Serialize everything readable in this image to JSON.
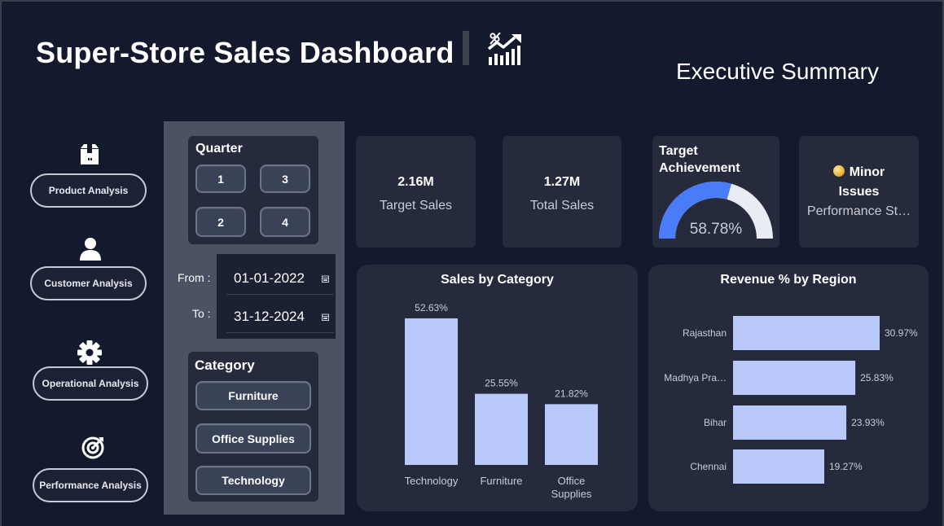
{
  "header": {
    "title": "Super-Store Sales Dashboard",
    "icon": "chart-growth-icon",
    "subtitle": "Executive Summary"
  },
  "nav": [
    {
      "label": "Product Analysis",
      "icon": "box-icon"
    },
    {
      "label": "Customer Analysis",
      "icon": "user-icon"
    },
    {
      "label": "Operational Analysis",
      "icon": "gear-icon"
    },
    {
      "label": "Performance Analysis",
      "icon": "target-icon"
    }
  ],
  "filters": {
    "quarter_heading": "Quarter",
    "quarters": [
      "1",
      "3",
      "2",
      "4"
    ],
    "from_label": "From :",
    "to_label": "To :",
    "from_date": "01-01-2022",
    "to_date": "31-12-2024",
    "category_heading": "Category",
    "categories": [
      "Furniture",
      "Office Supplies",
      "Technology"
    ]
  },
  "kpis": {
    "target_sales": {
      "value": "2.16M",
      "label": "Target Sales"
    },
    "total_sales": {
      "value": "1.27M",
      "label": "Total Sales"
    },
    "target_achievement": {
      "title_line1": "Target",
      "title_line2": "Achievement",
      "value": "58.78%",
      "fraction": 0.5878
    },
    "status": {
      "line1": "Minor",
      "line2": "Issues",
      "label": "Performance St…"
    }
  },
  "colors": {
    "background": "#141a2e",
    "card": "#252b3d",
    "bar": "#b9c9fb",
    "gauge_fill": "#4a7cf7",
    "gauge_track": "#e9ecf5"
  },
  "chart_data": [
    {
      "type": "bar",
      "title": "Sales by Category",
      "categories": [
        "Technology",
        "Furniture",
        "Office Supplies"
      ],
      "category_labels": [
        [
          "Technology"
        ],
        [
          "Furniture"
        ],
        [
          "Office",
          "Supplies"
        ]
      ],
      "values": [
        52.63,
        25.55,
        21.82
      ],
      "data_labels": [
        "52.63%",
        "25.55%",
        "21.82%"
      ],
      "ylim": [
        0,
        52.63
      ],
      "grid": false
    },
    {
      "type": "bar",
      "orientation": "horizontal",
      "title": "Revenue % by Region",
      "categories": [
        "Rajasthan",
        "Madhya Pra…",
        "Bihar",
        "Chennai"
      ],
      "values": [
        30.97,
        25.83,
        23.93,
        19.27
      ],
      "data_labels": [
        "30.97%",
        "25.83%",
        "23.93%",
        "19.27%"
      ],
      "xlim": [
        0,
        30.97
      ],
      "grid": false
    }
  ]
}
